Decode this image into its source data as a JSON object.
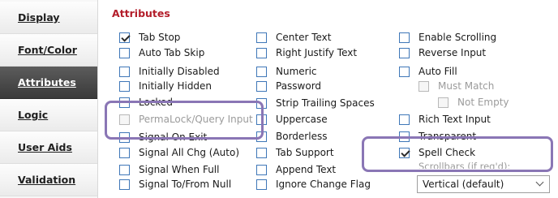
{
  "sidebar": {
    "items": [
      {
        "label": "Display",
        "active": false
      },
      {
        "label": "Font/Color",
        "active": false
      },
      {
        "label": "Attributes",
        "active": true
      },
      {
        "label": "Logic",
        "active": false
      },
      {
        "label": "User Aids",
        "active": false
      },
      {
        "label": "Validation",
        "active": false
      }
    ]
  },
  "section_title": "Attributes",
  "columns": [
    [
      {
        "label": "Tab Stop",
        "checked": true,
        "disabled": false
      },
      {
        "label": "Auto Tab Skip",
        "checked": false,
        "disabled": false
      },
      {
        "label": "Initially Disabled",
        "checked": false,
        "disabled": false
      },
      {
        "label": "Initially Hidden",
        "checked": false,
        "disabled": false
      },
      {
        "label": "Locked",
        "checked": false,
        "disabled": false
      },
      {
        "label": "PermaLock/Query Input",
        "checked": false,
        "disabled": true
      },
      {
        "label": "Signal On Exit",
        "checked": false,
        "disabled": false
      },
      {
        "label": "Signal All Chg (Auto)",
        "checked": false,
        "disabled": false
      },
      {
        "label": "Signal When Full",
        "checked": false,
        "disabled": false
      },
      {
        "label": "Signal To/From Null",
        "checked": false,
        "disabled": false
      }
    ],
    [
      {
        "label": "Center Text",
        "checked": false,
        "disabled": false
      },
      {
        "label": "Right Justify Text",
        "checked": false,
        "disabled": false
      },
      {
        "label": "Numeric",
        "checked": false,
        "disabled": false
      },
      {
        "label": "Password",
        "checked": false,
        "disabled": false
      },
      {
        "label": "Strip Trailing Spaces",
        "checked": false,
        "disabled": false
      },
      {
        "label": "Uppercase",
        "checked": false,
        "disabled": false
      },
      {
        "label": "Borderless",
        "checked": false,
        "disabled": false
      },
      {
        "label": "Tab Support",
        "checked": false,
        "disabled": false
      },
      {
        "label": "Append Text",
        "checked": false,
        "disabled": false
      },
      {
        "label": "Ignore Change Flag",
        "checked": false,
        "disabled": false
      }
    ],
    [
      {
        "label": "Enable Scrolling",
        "checked": false,
        "disabled": false
      },
      {
        "label": "Reverse Input",
        "checked": false,
        "disabled": false
      },
      {
        "label": "Auto Fill",
        "checked": false,
        "disabled": false
      },
      {
        "label": "Must Match",
        "checked": false,
        "disabled": true
      },
      {
        "label": "Not Empty",
        "checked": false,
        "disabled": true
      },
      {
        "label": "Rich Text Input",
        "checked": false,
        "disabled": false
      },
      {
        "label": "Transparent",
        "checked": false,
        "disabled": false
      },
      {
        "label": "Spell Check",
        "checked": true,
        "disabled": false
      }
    ]
  ],
  "scrollbars": {
    "label": "Scrollbars (if req'd):",
    "selected": "Vertical (default)"
  },
  "colors": {
    "title": "#b31d2a",
    "checkbox_border": "#3f77b8",
    "highlight": "#8a76b5",
    "active_nav": "#3a3a3a"
  }
}
